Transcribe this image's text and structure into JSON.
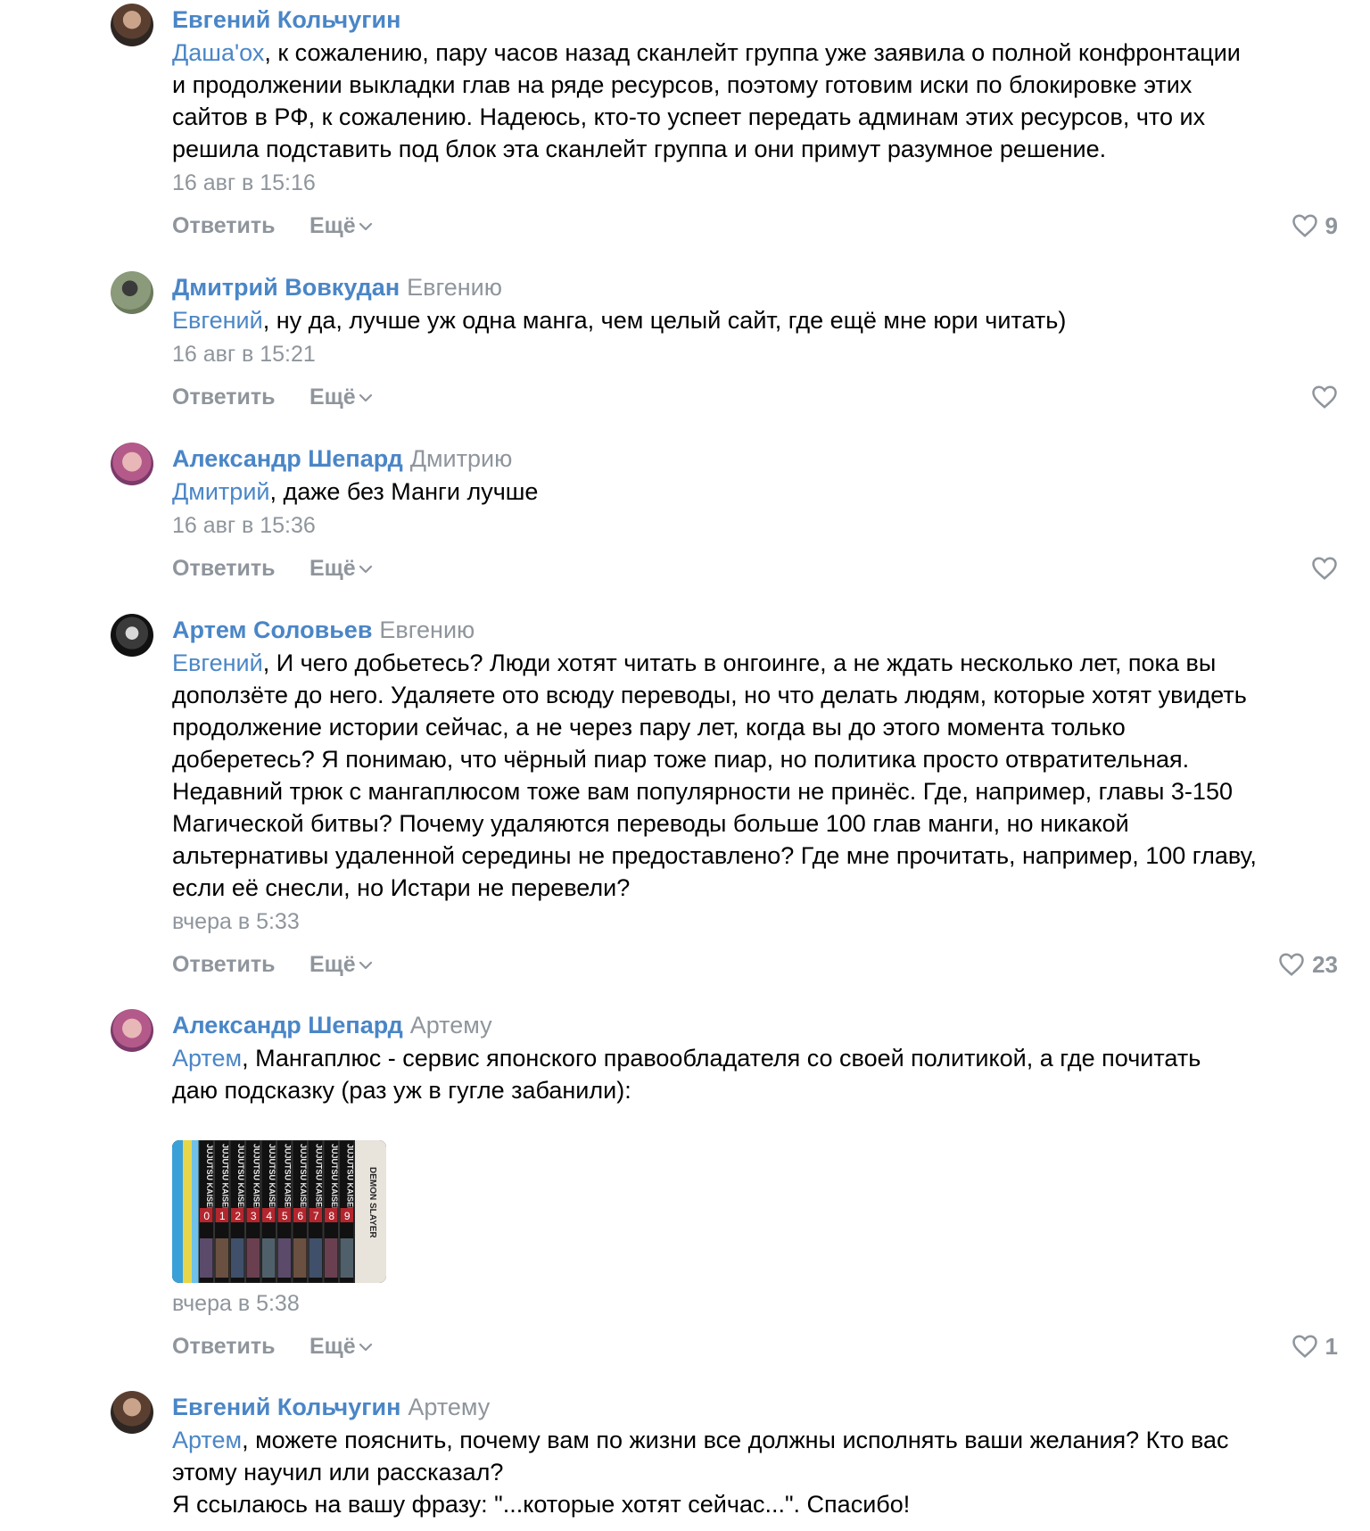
{
  "comments": [
    {
      "author": "Евгений Кольчугин",
      "reply_to": "",
      "mention": "Даша'ох",
      "text_lines": [
        ", к сожалению, пару часов назад сканлейт группа уже заявила о полной конфронтации",
        "и продолжении выкладки глав на ряде ресурсов, поэтому готовим иски по блокировке этих",
        "сайтов в РФ, к сожалению. Надеюсь, кто-то успеет передать админам этих ресурсов, что их",
        "решила подставить под блок эта сканлейт группа и они примут разумное решение."
      ],
      "date": "16 авг в 15:16",
      "likes": "9"
    },
    {
      "author": "Дмитрий Вовкудан",
      "reply_to": "Евгению",
      "mention": "Евгений",
      "text_lines": [
        ", ну да, лучше уж одна манга, чем целый сайт, где ещё мне юри читать)"
      ],
      "date": "16 авг в 15:21",
      "likes": ""
    },
    {
      "author": "Александр Шепард",
      "reply_to": "Дмитрию",
      "mention": "Дмитрий",
      "text_lines": [
        ", даже без Манги лучше"
      ],
      "date": "16 авг в 15:36",
      "likes": ""
    },
    {
      "author": "Артем Соловьев",
      "reply_to": "Евгению",
      "mention": "Евгений",
      "text_lines": [
        ", И чего добьетесь? Люди хотят читать в онгоинге, а не ждать несколько лет, пока вы",
        "доползёте до него. Удаляете ото всюду переводы, но что делать людям, которые хотят увидеть",
        "продолжение истории сейчас, а не через пару лет, когда вы до этого момента только",
        "доберетесь? Я понимаю, что чёрный пиар тоже пиар, но политика просто отвратительная.",
        "Недавний трюк с мангаплюсом тоже вам популярности не принёс. Где, например, главы 3-150",
        "Магической битвы? Почему удаляются переводы больше 100 глав манги, но никакой",
        "альтернативы удаленной середины не предоставлено? Где мне прочитать, например, 100 главу,",
        "если её снесли, но Истари не перевели?"
      ],
      "date": "вчера в 5:33",
      "likes": "23"
    },
    {
      "author": "Александр Шепард",
      "reply_to": "Артему",
      "mention": "Артем",
      "text_lines": [
        ", Мангаплюс - сервис японского правообладателя со своей политикой, а где почитать",
        "даю подсказку (раз уж в гугле забанили):"
      ],
      "date": "вчера в 5:38",
      "likes": "1"
    },
    {
      "author": "Евгений Кольчугин",
      "reply_to": "Артему",
      "mention": "Артем",
      "text_lines": [
        ", можете пояснить, почему вам по жизни все должны исполнять ваши желания? Кто вас",
        "этому научил или рассказал?",
        "Я ссылаюсь на вашу фразу: \"...которые хотят сейчас...\". Спасибо!"
      ],
      "date": "",
      "likes": ""
    }
  ],
  "actions": {
    "reply_label": "Ответить",
    "more_label": "Ещё"
  },
  "photo": {
    "spine_labels": [
      "JUJUTSU KAISEN",
      "DEMON SLAYER"
    ],
    "volume_numbers": [
      "0",
      "1",
      "2",
      "3",
      "4",
      "5",
      "6",
      "7",
      "8",
      "9"
    ]
  },
  "colors": {
    "link": "#4a86c7",
    "muted": "#8f959c",
    "text": "#000000"
  }
}
